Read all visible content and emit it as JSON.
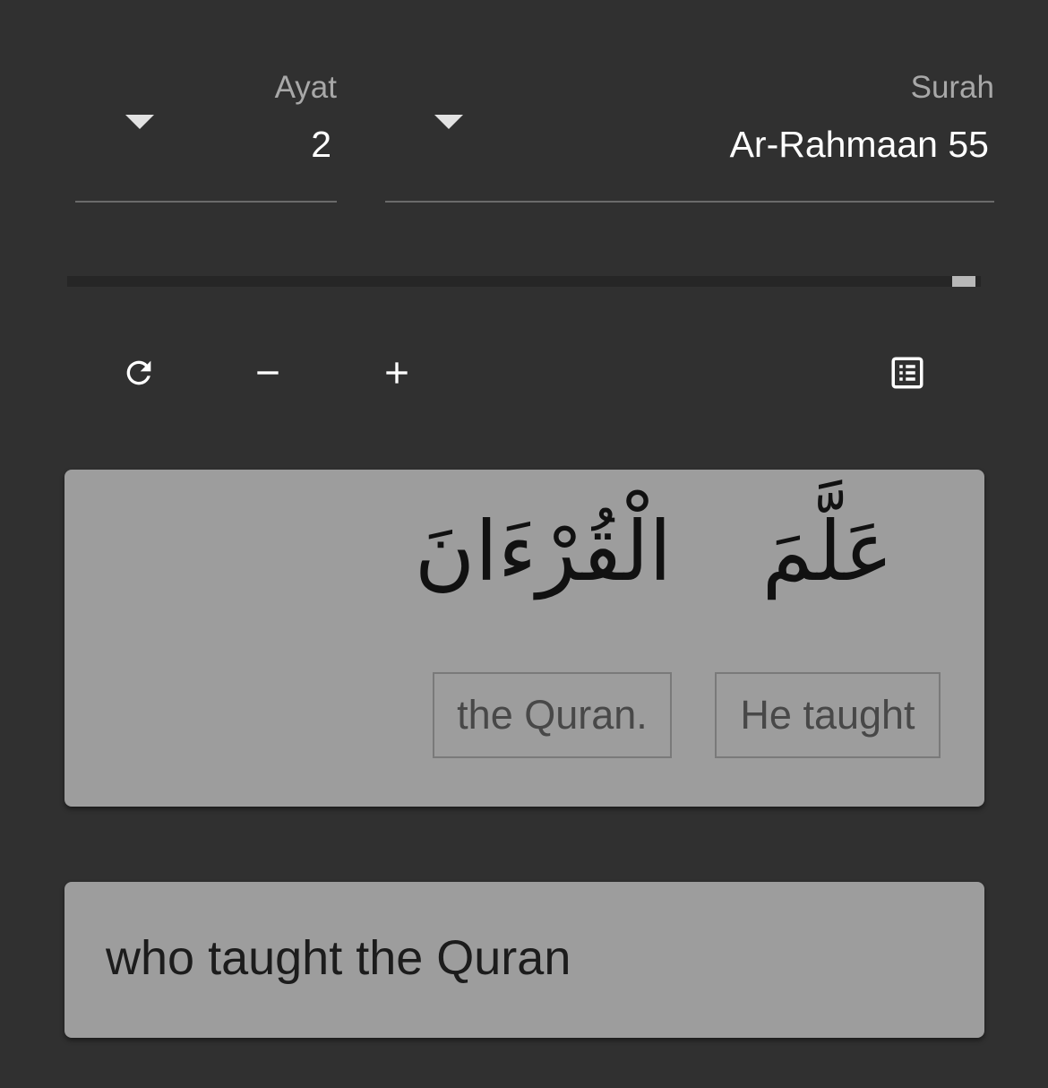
{
  "ayat_select": {
    "label": "Ayat",
    "value": "2"
  },
  "surah_select": {
    "label": "Surah",
    "value": "Ar-Rahmaan 55"
  },
  "ayat_progress": 1.0,
  "toolbar": {
    "refresh_icon": "refresh-icon",
    "minus_icon": "minus-icon",
    "plus_icon": "plus-icon",
    "list_icon": "list-view-icon"
  },
  "words": [
    {
      "arabic": "عَلَّمَ",
      "meaning": "He taught"
    },
    {
      "arabic": "الْقُرْءَانَ",
      "meaning": "the Quran."
    }
  ],
  "translation": "who taught the Quran",
  "colors": {
    "background": "#303030",
    "card": "#9d9d9d",
    "accent_thumb": "#b8b8b8"
  }
}
